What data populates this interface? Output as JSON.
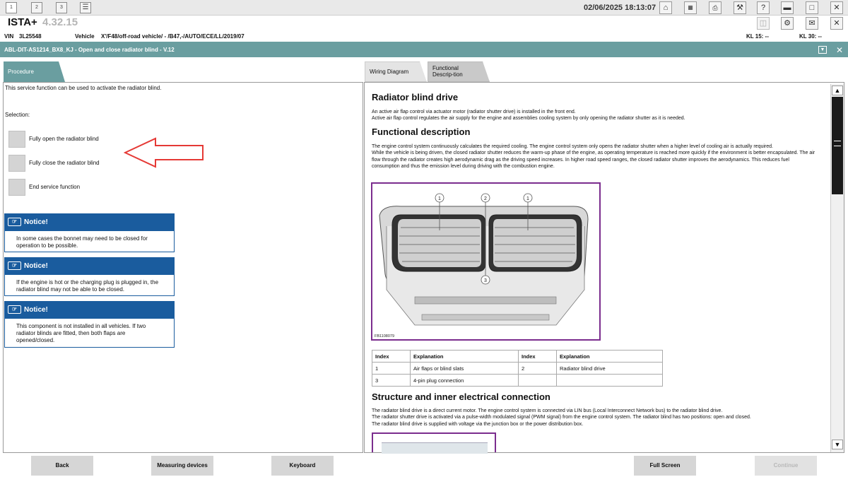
{
  "topbar": {
    "window_buttons": [
      "1",
      "2",
      "3"
    ],
    "datetime": "02/06/2025 18:13:07",
    "icons": [
      "home-icon",
      "connection-icon",
      "print-icon",
      "wrench-icon",
      "help-icon",
      "minimize-icon",
      "maximize-icon",
      "close-icon"
    ],
    "icons_row2": [
      "copy-icon",
      "settings-icon",
      "mail-icon",
      "close-icon"
    ]
  },
  "app": {
    "title": "ISTA+",
    "version": "4.32.15"
  },
  "info": {
    "vin_label": "VIN",
    "vin": "3L25548",
    "vehicle_label": "Vehicle",
    "vehicle": "X'/F48/off-road vehicle/ - /B47,-/AUTO/ECE/LL/2019/07",
    "kl15": "KL 15:  --",
    "kl30": "KL 30:  --"
  },
  "header": {
    "title": "ABL-DIT-AS1214_BX8_KJ - Open and close radiator blind - V.12"
  },
  "left": {
    "tab": "Procedure",
    "intro": "This service function can be used to activate the radiator blind.",
    "selection_label": "Selection:",
    "options": [
      "Fully open the radiator blind",
      "Fully close the radiator blind",
      "End service function"
    ],
    "notices": [
      {
        "title": "Notice!",
        "body": "In some cases the bonnet may need to be closed for operation to be possible."
      },
      {
        "title": "Notice!",
        "body": "If the engine is hot or the charging plug is plugged in, the radiator blind may not be able to be closed."
      },
      {
        "title": "Notice!",
        "body": "This component is not installed in all vehicles. If two radiator blinds are fitted, then both flaps are opened/closed."
      }
    ]
  },
  "right": {
    "tabs": [
      "Wiring Diagram",
      "Functional Descrip-tion"
    ],
    "heading1": "Radiator blind drive",
    "para1": "An active air flap control via actuator motor (radiator shutter drive) is installed in the front end.",
    "para1b": "Active air flap control regulates the air supply for the engine and assemblies cooling system by only opening the radiator shutter as it is needed.",
    "heading2": "Functional description",
    "para2": "The engine control system continuously calculates the required cooling. The engine control system only opens the radiator shutter when a higher level of cooling air is actually required.",
    "para3": "While the vehicle is being driven, the closed radiator shutter reduces the warm-up phase of the engine, as operating temperature is reached more quickly if the environment is better encapsulated. The air flow through the radiator creates high aerodynamic drag as the driving speed increases. In higher road speed ranges, the closed radiator shutter improves the aerodynamics. This reduces fuel consumption and thus the emission level during driving with the combustion engine.",
    "figure_id": "FB1108079",
    "callouts": [
      "1",
      "2",
      "1",
      "3"
    ],
    "table": {
      "headers": [
        "Index",
        "Explanation",
        "Index",
        "Explanation"
      ],
      "rows": [
        [
          "1",
          "Air flaps or blind slats",
          "2",
          "Radiator blind drive"
        ],
        [
          "3",
          "4-pin plug connection",
          "",
          ""
        ]
      ]
    },
    "heading3": "Structure and inner electrical connection",
    "para4": "The radiator blind drive is a direct current motor. The engine control system is connected via LIN bus (Local Interconnect Network bus) to the radiator blind drive.",
    "para5": "The radiator shutter drive is activated via a pulse-width modulated signal (PWM signal) from the engine control system. The radiator blind has two positions: open and closed.",
    "para6": "The radiator blind drive is supplied with voltage via the junction box or the power distribution box."
  },
  "bottom": {
    "back": "Back",
    "measuring": "Measuring devices",
    "keyboard": "Keyboard",
    "fullscreen": "Full Screen",
    "continue": "Continue"
  },
  "colors": {
    "teal": "#6a9ea0",
    "notice_blue": "#1a5c9e",
    "figure_border": "#7b2d8e",
    "arrow_red": "#e53935"
  }
}
